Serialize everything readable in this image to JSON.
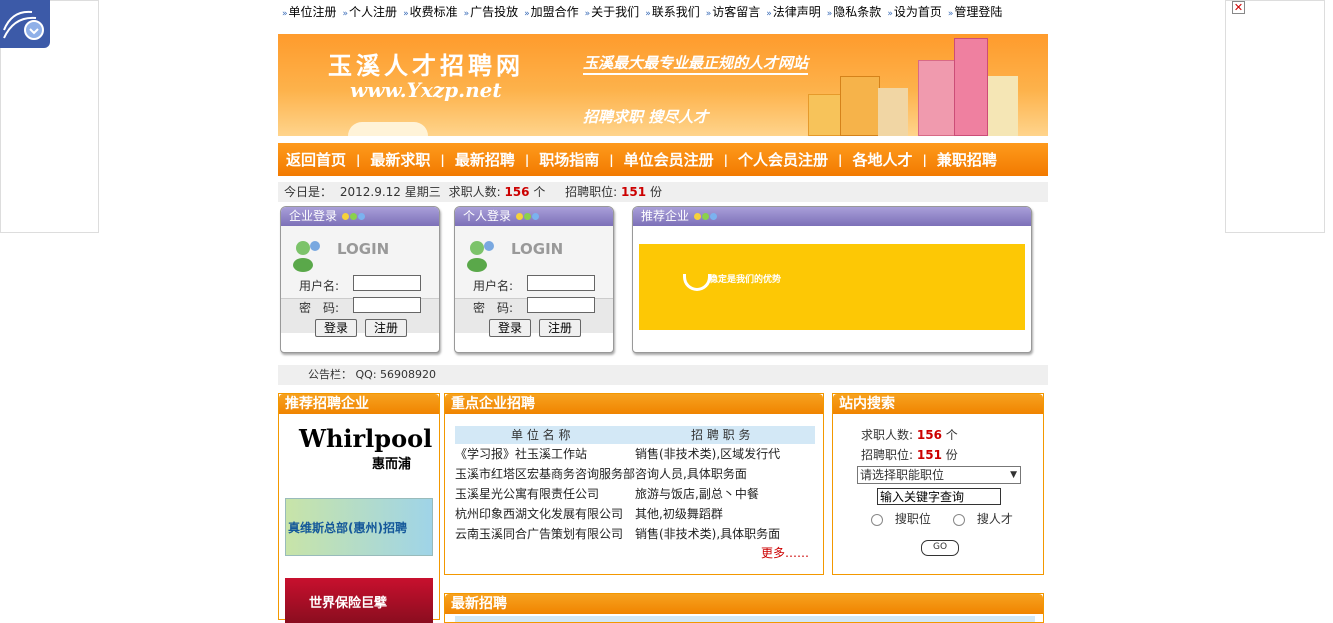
{
  "topnav": [
    "单位注册",
    "个人注册",
    "收费标准",
    "广告投放",
    "加盟合作",
    "关于我们",
    "联系我们",
    "访客留言",
    "法律声明",
    "隐私条款",
    "设为首页",
    "管理登陆"
  ],
  "banner": {
    "logo": "玉溪人才招聘网",
    "url": "www.Yxzp.net",
    "slogan1": "玉溪最大最专业最正规的人才网站",
    "slogan2": "招聘求职  搜尽人才"
  },
  "mainnav": [
    "返回首页",
    "最新求职",
    "最新招聘",
    "职场指南",
    "单位会员注册",
    "个人会员注册",
    "各地人才",
    "兼职招聘"
  ],
  "info": {
    "today_label": "今日是：",
    "date": "2012.9.12 星期三",
    "job_seekers_label": "求职人数:",
    "job_seekers": "156",
    "unit1": "个",
    "positions_label": "招聘职位:",
    "positions": "151",
    "unit2": "份"
  },
  "login_company": {
    "title": "企业登录",
    "logo_text": "LOGIN",
    "username_label": "用户名:",
    "password_label": "密　码:",
    "login_btn": "登录",
    "register_btn": "注册"
  },
  "login_person": {
    "title": "个人登录",
    "logo_text": "LOGIN",
    "username_label": "用户名:",
    "password_label": "密　码:",
    "login_btn": "登录",
    "register_btn": "注册"
  },
  "recommend": {
    "title": "推荐企业",
    "banner_text": "稳定是我们的优势"
  },
  "notice": {
    "label": "公告栏：",
    "text": "QQ: 56908920"
  },
  "left_col": {
    "title": "推荐招聘企业",
    "whirlpool": "Whirlpool",
    "whirlpool_cn": "惠而浦",
    "ad1": "真维斯总部(惠州)招聘",
    "ad2": "世界保险巨擘"
  },
  "key_jobs": {
    "title": "重点企业招聘",
    "col1": "单 位 名 称",
    "col2": "招 聘 职 务",
    "rows": [
      [
        "《学习报》社玉溪工作站",
        "销售(非技术类),区域发行代"
      ],
      [
        "玉溪市红塔区宏基商务咨询服务部",
        "咨询人员,具体职务面"
      ],
      [
        "玉溪星光公寓有限责任公司",
        "旅游与饭店,副总丶中餐"
      ],
      [
        "杭州印象西湖文化发展有限公司",
        "其他,初级舞蹈群"
      ],
      [
        "云南玉溪同合广告策划有限公司",
        "销售(非技术类),具体职务面"
      ]
    ],
    "more": "更多……"
  },
  "search": {
    "title": "站内搜索",
    "seekers_label": "求职人数:",
    "seekers": "156",
    "unit1": "个",
    "positions_label": "招聘职位:",
    "positions": "151",
    "unit2": "份",
    "select_value": "请选择职能职位",
    "keyword_placeholder": "输入关键字查询",
    "radio1": "搜职位",
    "radio2": "搜人才",
    "go": "GO"
  },
  "latest": {
    "title": "最新招聘"
  }
}
